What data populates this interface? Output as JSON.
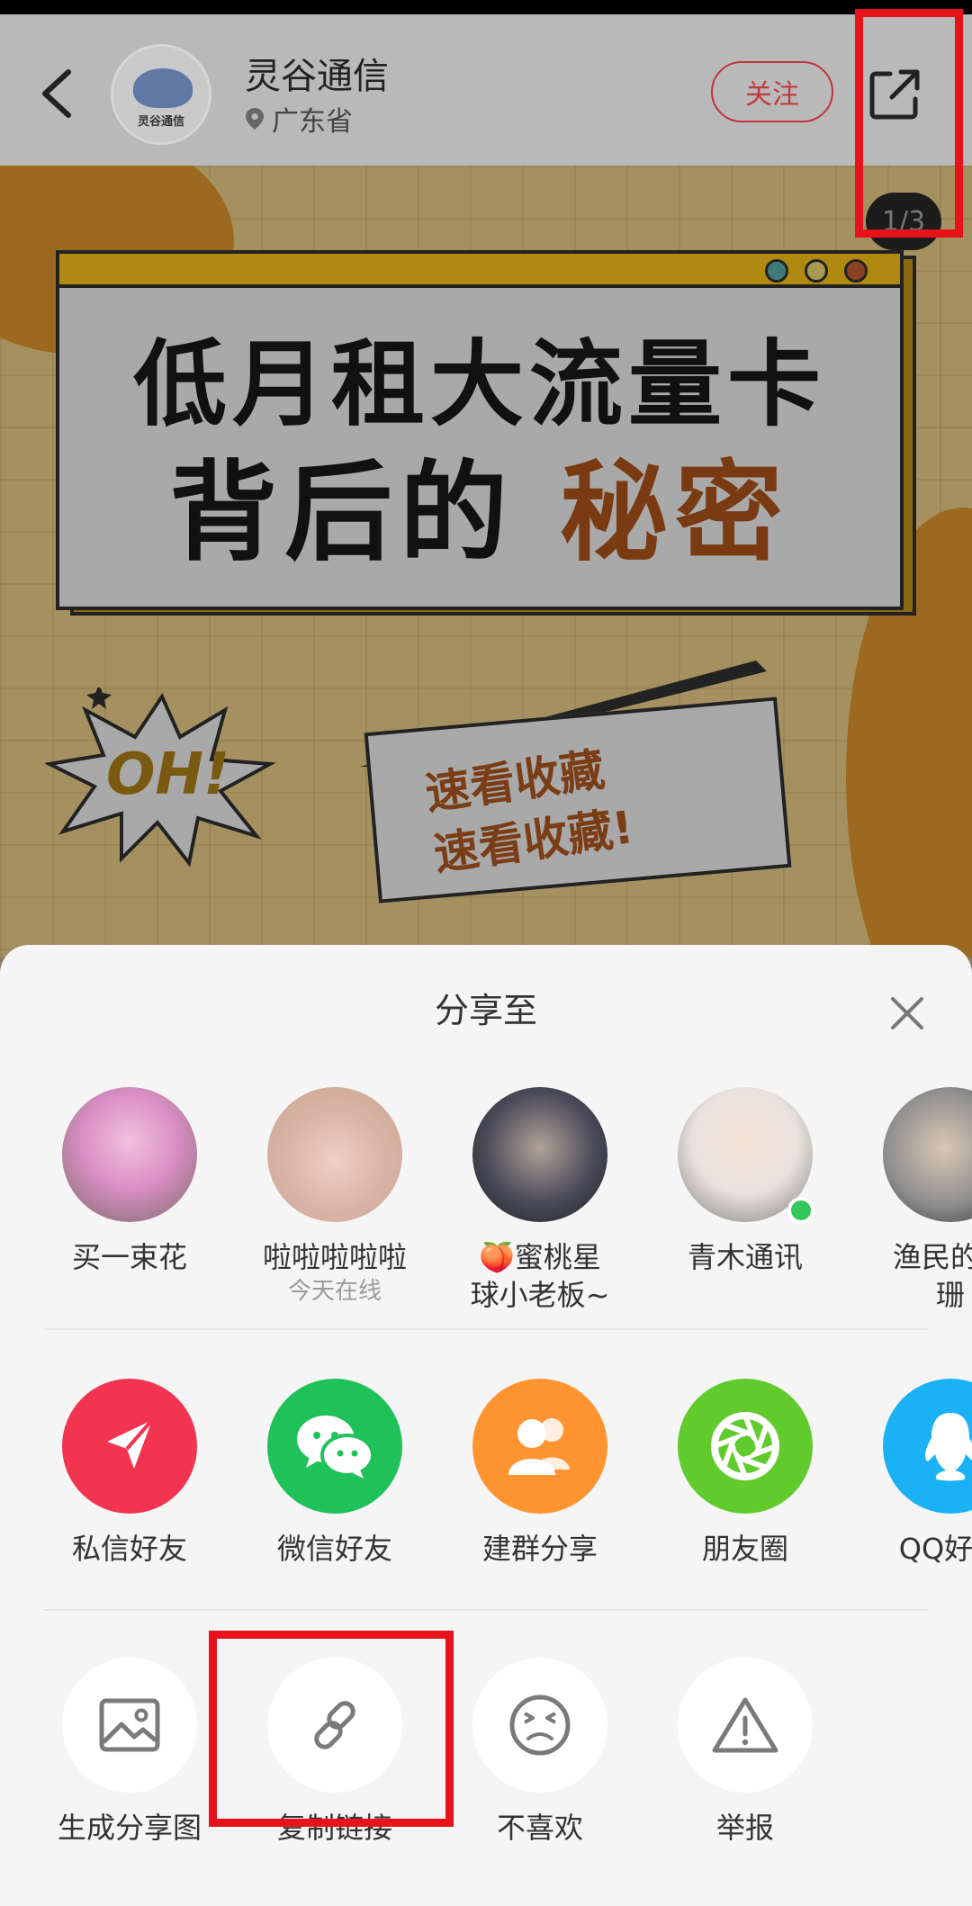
{
  "header": {
    "shop_name": "灵谷通信",
    "location": "广东省",
    "follow_label": "关注",
    "avatar_text": "灵谷通信",
    "page_indicator": "1/3"
  },
  "poster": {
    "title_line1": "低月租大流量卡",
    "title_line2_prefix": "背后的",
    "title_line2_accent": "秘密",
    "badge": "OH!",
    "note_line1": "速看收藏",
    "note_line2": "速看收藏!"
  },
  "share_sheet": {
    "title": "分享至",
    "contacts": [
      {
        "name": "买一束花",
        "status": "",
        "color": "#d98fc4"
      },
      {
        "name": "啦啦啦啦啦",
        "status": "今天在线",
        "color": "#d9b3a8"
      },
      {
        "name": "🍑蜜桃星",
        "name_line2": "球小老板~",
        "status": "",
        "color": "#4a4a58"
      },
      {
        "name": "青木通讯",
        "status": "",
        "color": "#e9e2dc"
      },
      {
        "name": "渔民的开",
        "name_line2": "珊",
        "status": "",
        "color": "#8e8e8e"
      }
    ],
    "apps": [
      {
        "label": "私信好友",
        "color": "#f23450",
        "icon": "paper-plane-icon"
      },
      {
        "label": "微信好友",
        "color": "#21c15a",
        "icon": "wechat-icon"
      },
      {
        "label": "建群分享",
        "color": "#ff9430",
        "icon": "group-icon"
      },
      {
        "label": "朋友圈",
        "color": "#61cb2d",
        "icon": "aperture-icon"
      },
      {
        "label": "QQ好友",
        "color": "#1ab2f5",
        "icon": "qq-penguin-icon"
      }
    ],
    "actions": [
      {
        "label": "生成分享图",
        "icon": "image-icon"
      },
      {
        "label": "复制链接",
        "icon": "link-icon"
      },
      {
        "label": "不喜欢",
        "icon": "dislike-face-icon"
      },
      {
        "label": "举报",
        "icon": "warning-icon"
      }
    ]
  },
  "annotation_color": "#e8121b"
}
